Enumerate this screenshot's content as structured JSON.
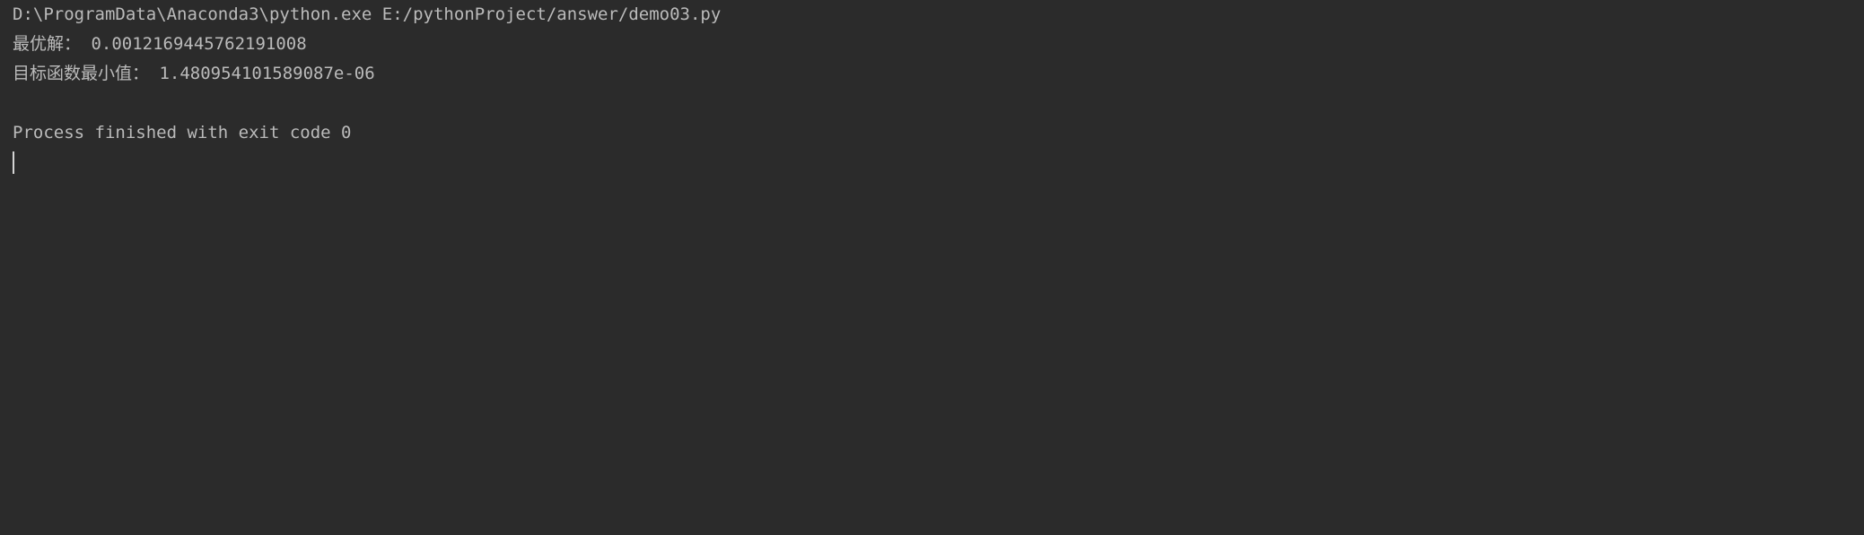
{
  "console": {
    "command": "D:\\ProgramData\\Anaconda3\\python.exe E:/pythonProject/answer/demo03.py",
    "output": [
      "最优解： 0.0012169445762191008",
      "目标函数最小值： 1.480954101589087e-06"
    ],
    "exit_message": "Process finished with exit code 0"
  },
  "colors": {
    "background": "#2b2b2b",
    "text": "#bbbbbb",
    "cursor": "#d4d4d4"
  }
}
